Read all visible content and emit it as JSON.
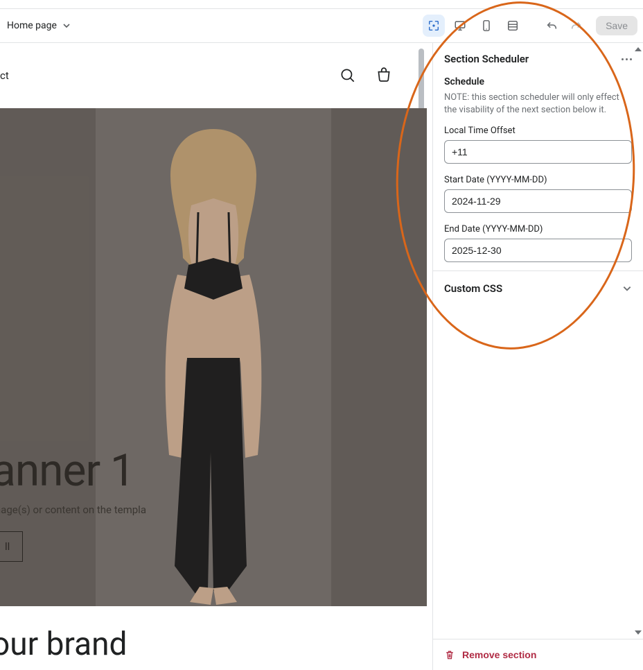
{
  "topbar": {
    "page_label": "Home page",
    "save_label": "Save"
  },
  "preview": {
    "header_link": "ct",
    "hero": {
      "title": "anner 1",
      "subtitle": "mage(s) or content on the templa",
      "cta": "ll"
    },
    "brand_heading": "our brand"
  },
  "panel": {
    "title": "Section Scheduler",
    "schedule_heading": "Schedule",
    "note": "NOTE: this section scheduler will only effect the visability of the next section below it.",
    "fields": {
      "offset_label": "Local Time Offset",
      "offset_value": "+11",
      "start_label": "Start Date (YYYY-MM-DD)",
      "start_value": "2024-11-29",
      "end_label": "End Date (YYYY-MM-DD)",
      "end_value": "2025-12-30"
    },
    "custom_css_label": "Custom CSS",
    "remove_label": "Remove section"
  }
}
